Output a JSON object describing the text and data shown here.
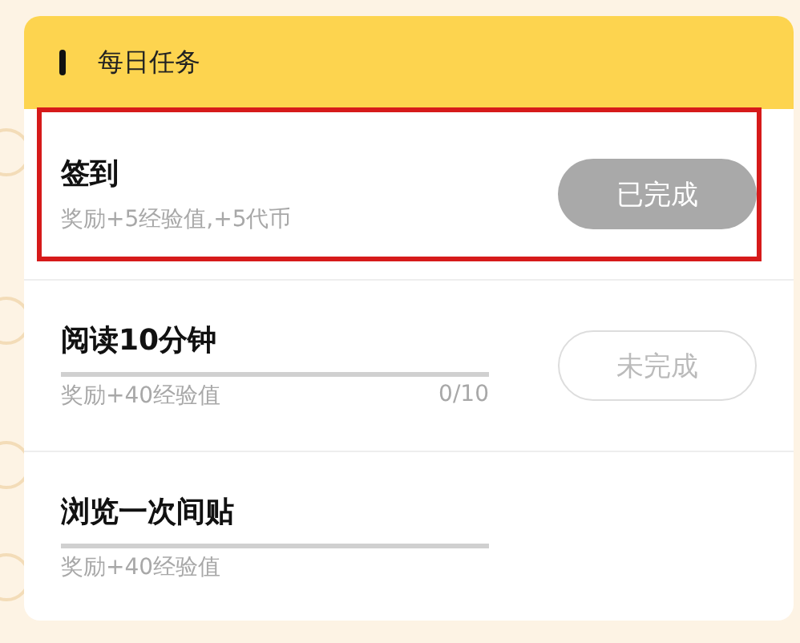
{
  "section": {
    "title": "每日任务"
  },
  "tasks": [
    {
      "title": "签到",
      "reward": "奖励+5经验值,+5代币",
      "highlighted": true,
      "status": {
        "kind": "done",
        "label": "已完成"
      }
    },
    {
      "title": "阅读10分钟",
      "reward": "奖励+40经验值",
      "highlighted": false,
      "level": 0,
      "count": "0/10",
      "status": {
        "kind": "todo",
        "label": "未完成"
      }
    },
    {
      "title": "浏览一次间贴",
      "reward": "奖励+40经验值",
      "highlighted": false,
      "level": 0
    }
  ]
}
